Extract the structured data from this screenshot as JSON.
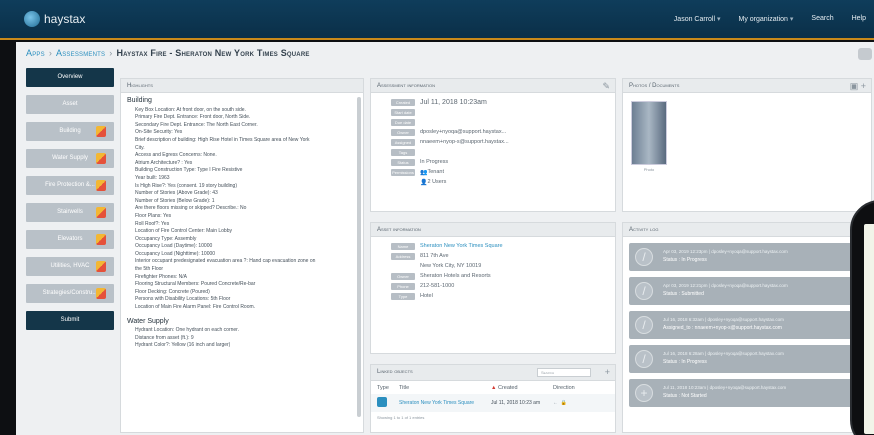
{
  "app": {
    "logo_text": "haystax"
  },
  "topnav": {
    "user": "Jason Carroll",
    "org": "My organization",
    "search": "Search",
    "help": "Help"
  },
  "breadcrumb": {
    "apps": "Apps",
    "assessments": "Assessments",
    "current": "Haystax Fire - Sheraton New York Times Square"
  },
  "nav": {
    "overview": "Overview",
    "items": [
      "Asset",
      "Building",
      "Water Supply",
      "Fire Protection &...",
      "Stairwells",
      "Elevators",
      "Utilities, HVAC",
      "Strategies/Constru..."
    ],
    "submit": "Submit"
  },
  "highlights": {
    "title": "Highlights",
    "section1": "Building",
    "building_rows": [
      "Key Box Location: At front door, on the south side.",
      "Primary Fire Dept. Entrance: Front door, North Side.",
      "Secondary Fire Dept. Entrance: The North East Corner.",
      "On-Site Security: Yes",
      "Brief description of building: High Rise Hotel in Times Square area of New York",
      "City.",
      "Access and Egress Concerns: None.",
      "Atrium Architecture? : Yes",
      "Building Construction Type: Type I Fire Resistive",
      "Year built: 1963",
      "Is High Rise?: Yes (consent. 19 story building)",
      "Number of Stories (Above Grade): 43",
      "Number of Stories (Below Grade): 1",
      "Are there floors missing or skipped? Describe.: No",
      "Floor Plans: Yes",
      "Roll Roof?: Yes",
      "Location of Fire Control Center: Main Lobby",
      "Occupancy Type: Assembly",
      "Occupancy Load (Daytime): 10000",
      "Occupancy Load (Nighttime): 10000",
      "Interior occupant predesignated evacuation area ?: Hand cap evacuation zone on",
      "the 5th Floor",
      "Firefighter Phones: N/A",
      "Flooring Structural Members: Poured Concrete/Re-bar",
      "Floor Decking: Concrete (Poured)",
      "Persons with Disability Locations: 5th Floor",
      "Location of Main Fire Alarm Panel: Fire Control Room."
    ],
    "section2": "Water Supply",
    "water_rows": [
      "Hydrant Location: One hydrant on each corner.",
      "Distance from asset (ft.): 9",
      "Hydrant Color?: Yellow (16 inch and larger)"
    ]
  },
  "assessment_info": {
    "title": "Assessment information",
    "rows": [
      {
        "key": "Created",
        "value": "Jul 11, 2018 10:23am",
        "big": true
      },
      {
        "key": "Start date",
        "value": ""
      },
      {
        "key": "Due date",
        "value": ""
      },
      {
        "key": "Owner",
        "value": "dposley+nyoqa@support.haystax..."
      },
      {
        "key": "Assigned",
        "value": "nnaeem+nyop-s@support.haystax..."
      },
      {
        "key": "Tags",
        "value": ""
      },
      {
        "key": "Status",
        "value": "In Progress"
      },
      {
        "key": "Permissions",
        "value": "Tenant",
        "icon": "people-icon"
      },
      {
        "key": "",
        "value": "2 Users",
        "icon": "user-icon"
      }
    ]
  },
  "asset_info": {
    "title": "Asset information",
    "rows": [
      {
        "key": "Name",
        "value": "Sheraton New York Times Square",
        "link": true
      },
      {
        "key": "Address",
        "value": "811 7th Ave"
      },
      {
        "key": "",
        "value": "New York City, NY 10019"
      },
      {
        "key": "Owner",
        "value": "Sheraton Hotels and Resorts"
      },
      {
        "key": "Phone",
        "value": "212-581-1000"
      },
      {
        "key": "Type",
        "value": "Hotel"
      }
    ]
  },
  "linked": {
    "title": "Linked objects",
    "search_placeholder": "Search",
    "cols": {
      "type": "Type",
      "title": "Title",
      "created": "Created",
      "direction": "Direction"
    },
    "row": {
      "title": "Sheraton New York Times Square",
      "created": "Jul 11, 2018 10:23 am"
    },
    "footer": "Showing 1 to 1 of 1 entries"
  },
  "photos": {
    "title": "Photos / Documents",
    "caption": "Photo"
  },
  "activity": {
    "title": "Activity log",
    "items": [
      {
        "line1": "Apr 03, 2019 12:23pm | dposley+nyoqa@support.haystax.com",
        "line2": "Status : In Progress",
        "icon": "circle-icon"
      },
      {
        "line1": "Apr 03, 2019 12:21pm | dposley+nyoqa@support.haystax.com",
        "line2": "Status : Submitted",
        "icon": "circle-icon"
      },
      {
        "line1": "Jul 16, 2018 6:32am | dposley+nyoqa@support.haystax.com",
        "line2": "Assigned_to : nnaeem+nyop-s@support.haystax.com",
        "icon": "circle-icon"
      },
      {
        "line1": "Jul 16, 2018 6:28am | dposley+nyoqa@support.haystax.com",
        "line2": "Status : In Progress",
        "icon": "circle-icon"
      },
      {
        "line1": "Jul 11, 2018 10:23am | dposley+nyoqa@support.haystax.com",
        "line2": "Status : Not Started",
        "icon": "plus-circle-icon"
      }
    ]
  }
}
